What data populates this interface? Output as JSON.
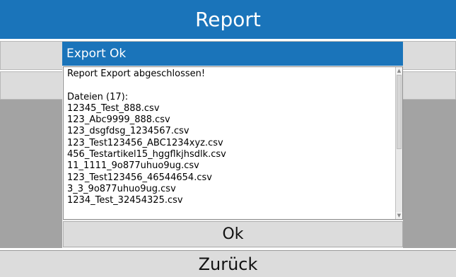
{
  "window": {
    "title": "Report"
  },
  "dialog": {
    "title": "Export Ok",
    "message_lines": [
      "Report Export abgeschlossen!",
      "",
      "Dateien (17):",
      "12345_Test_888.csv",
      "123_Abc9999_888.csv",
      "123_dsgfdsg_1234567.csv",
      "123_Test123456_ABC1234xyz.csv",
      "456_Testartikel15_hggflkjhsdlk.csv",
      "11_1111_9o877uhuo9ug.csv",
      "123_Test123456_46544654.csv",
      "3_3_9o877uhuo9ug.csv",
      "1234_Test_32454325.csv"
    ],
    "ok_label": "Ok"
  },
  "footer": {
    "back_label": "Zurück"
  },
  "colors": {
    "accent": "#1a74ba",
    "button_bg": "#dcdcdc",
    "overlay": "#a3a3a3"
  },
  "icons": {
    "scroll_up": "scroll-up-arrow-icon",
    "scroll_down": "scroll-down-arrow-icon"
  }
}
